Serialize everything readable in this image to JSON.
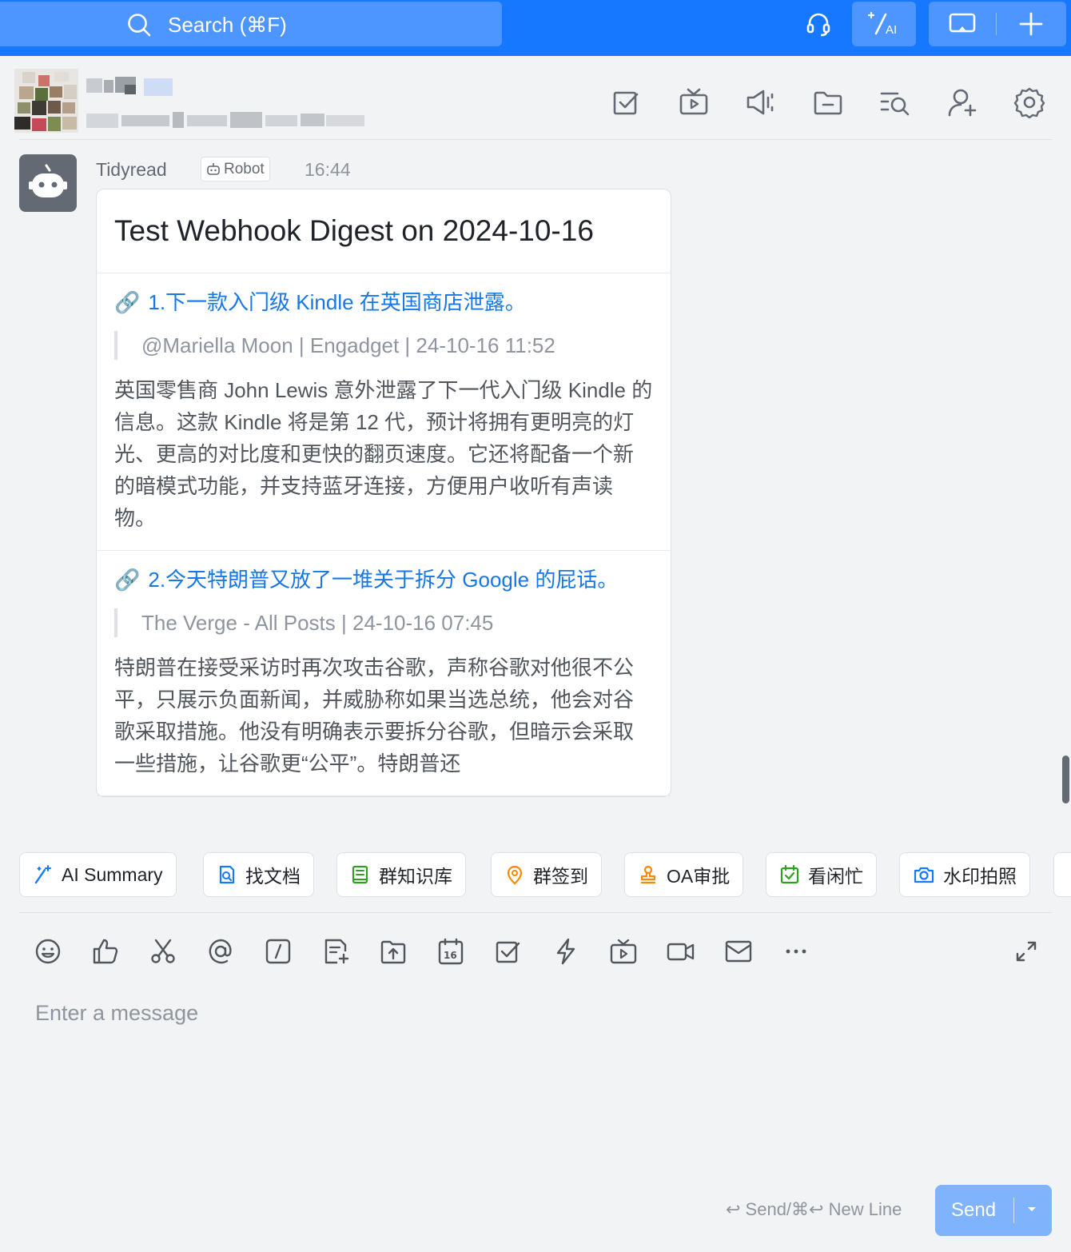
{
  "search": {
    "placeholder": "Search (⌘F)"
  },
  "message": {
    "sender": "Tidyread",
    "tag": "Robot",
    "time": "16:44",
    "card_title": "Test Webhook Digest on 2024-10-16",
    "items": [
      {
        "title": "1.下一款入门级 Kindle 在英国商店泄露。",
        "source": "@Mariella Moon | Engadget | 24-10-16 11:52",
        "body": "英国零售商 John Lewis 意外泄露了下一代入门级 Kindle 的信息。这款 Kindle 将是第 12 代，预计将拥有更明亮的灯光、更高的对比度和更快的翻页速度。它还将配备一个新的暗模式功能，并支持蓝牙连接，方便用户收听有声读物。"
      },
      {
        "title": "2.今天特朗普又放了一堆关于拆分 Google 的屁话。",
        "source": "The Verge - All Posts | 24-10-16 07:45",
        "body": "特朗普在接受采访时再次攻击谷歌，声称谷歌对他很不公平，只展示负面新闻，并威胁称如果当选总统，他会对谷歌采取措施。他没有明确表示要拆分谷歌，但暗示会采取一些措施，让谷歌更“公平”。特朗普还"
      }
    ]
  },
  "quick_actions": [
    {
      "label": "AI Summary",
      "icon": "ai-sparkle-icon",
      "color": "#1677ff"
    },
    {
      "label": "找文档",
      "icon": "doc-search-icon",
      "color": "#1677ff"
    },
    {
      "label": "群知识库",
      "icon": "knowledge-book-icon",
      "color": "#2ea121"
    },
    {
      "label": "群签到",
      "icon": "location-pin-icon",
      "color": "#ff8800"
    },
    {
      "label": "OA审批",
      "icon": "stamp-icon",
      "color": "#ff8800"
    },
    {
      "label": "看闲忙",
      "icon": "calendar-check-icon",
      "color": "#2ea121"
    },
    {
      "label": "水印拍照",
      "icon": "camera-icon",
      "color": "#1677ff"
    }
  ],
  "composer": {
    "placeholder": "Enter a message",
    "hint": "↩ Send/⌘↩ New Line",
    "send_label": "Send"
  }
}
